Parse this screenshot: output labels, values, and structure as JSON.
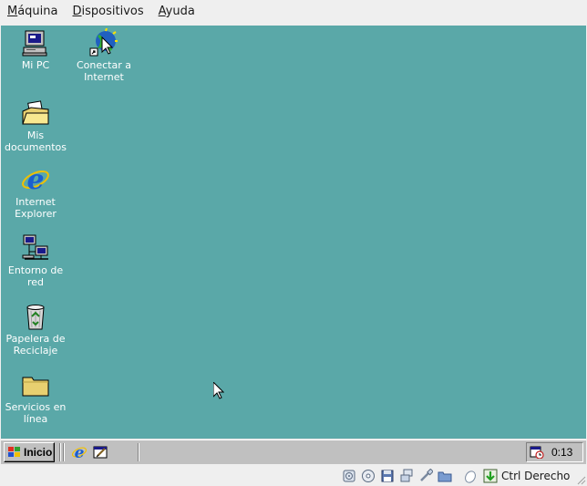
{
  "menubar": {
    "items": [
      {
        "label": "Máquina",
        "mnemonic": "M",
        "rest": "áquina"
      },
      {
        "label": "Dispositivos",
        "mnemonic": "D",
        "rest": "ispositivos"
      },
      {
        "label": "Ayuda",
        "mnemonic": "A",
        "rest": "yuda"
      }
    ]
  },
  "desktop": {
    "background": "#5aa8a8",
    "icons": [
      {
        "name": "my-computer",
        "label": "Mi PC"
      },
      {
        "name": "connect-internet",
        "label": "Conectar a\nInternet"
      },
      {
        "name": "my-documents",
        "label": "Mis\ndocumentos"
      },
      {
        "name": "internet-explorer",
        "label": "Internet\nExplorer"
      },
      {
        "name": "network-neighborhood",
        "label": "Entorno de red"
      },
      {
        "name": "recycle-bin",
        "label": "Papelera de\nReciclaje"
      },
      {
        "name": "online-services",
        "label": "Servicios en\nlínea"
      }
    ]
  },
  "taskbar": {
    "start_label": "Inicio",
    "quick_launch": [
      "internet-explorer-icon",
      "show-desktop-icon"
    ],
    "clock": "0:13",
    "tray_icons": [
      "task-scheduler-icon"
    ]
  },
  "statusbar": {
    "host_key": "Ctrl Derecho",
    "icons": [
      "hard-disk-icon",
      "optical-drive-icon",
      "floppy-icon",
      "network-icon",
      "shared-folders-icon",
      "usb-icon",
      "mouse-integration-icon",
      "keyboard-capture-icon"
    ]
  }
}
